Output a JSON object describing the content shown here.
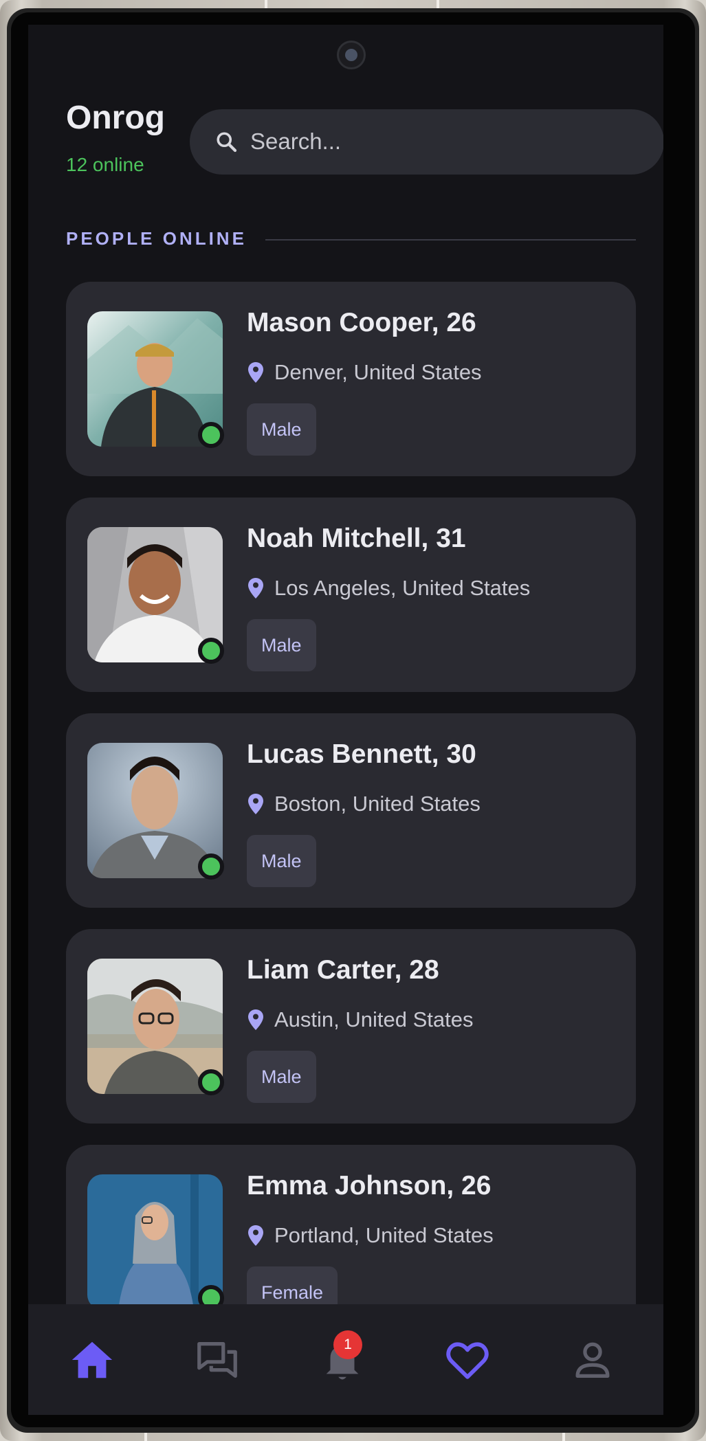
{
  "app": {
    "title": "Onrog",
    "online_count": "12 online"
  },
  "search": {
    "placeholder": "Search..."
  },
  "section": {
    "label": "PEOPLE ONLINE"
  },
  "people": [
    {
      "name": "Mason Cooper, 26",
      "location": "Denver, United States",
      "gender": "Male",
      "online": true
    },
    {
      "name": "Noah Mitchell, 31",
      "location": "Los Angeles, United States",
      "gender": "Male",
      "online": true
    },
    {
      "name": "Lucas Bennett, 30",
      "location": "Boston, United States",
      "gender": "Male",
      "online": true
    },
    {
      "name": "Liam Carter, 28",
      "location": "Austin, United States",
      "gender": "Male",
      "online": true
    },
    {
      "name": "Emma Johnson, 26",
      "location": "Portland, United States",
      "gender": "Female",
      "online": true
    }
  ],
  "nav": {
    "items": [
      {
        "icon": "home-icon",
        "active": true
      },
      {
        "icon": "chat-icon",
        "active": false
      },
      {
        "icon": "bell-icon",
        "active": false,
        "badge": "1"
      },
      {
        "icon": "heart-icon",
        "active": false
      },
      {
        "icon": "profile-icon",
        "active": false
      }
    ]
  },
  "colors": {
    "accent": "#6c5cf5",
    "online": "#4cc35c",
    "badge": "#e53535",
    "background": "#141418",
    "card": "#2a2a31"
  }
}
